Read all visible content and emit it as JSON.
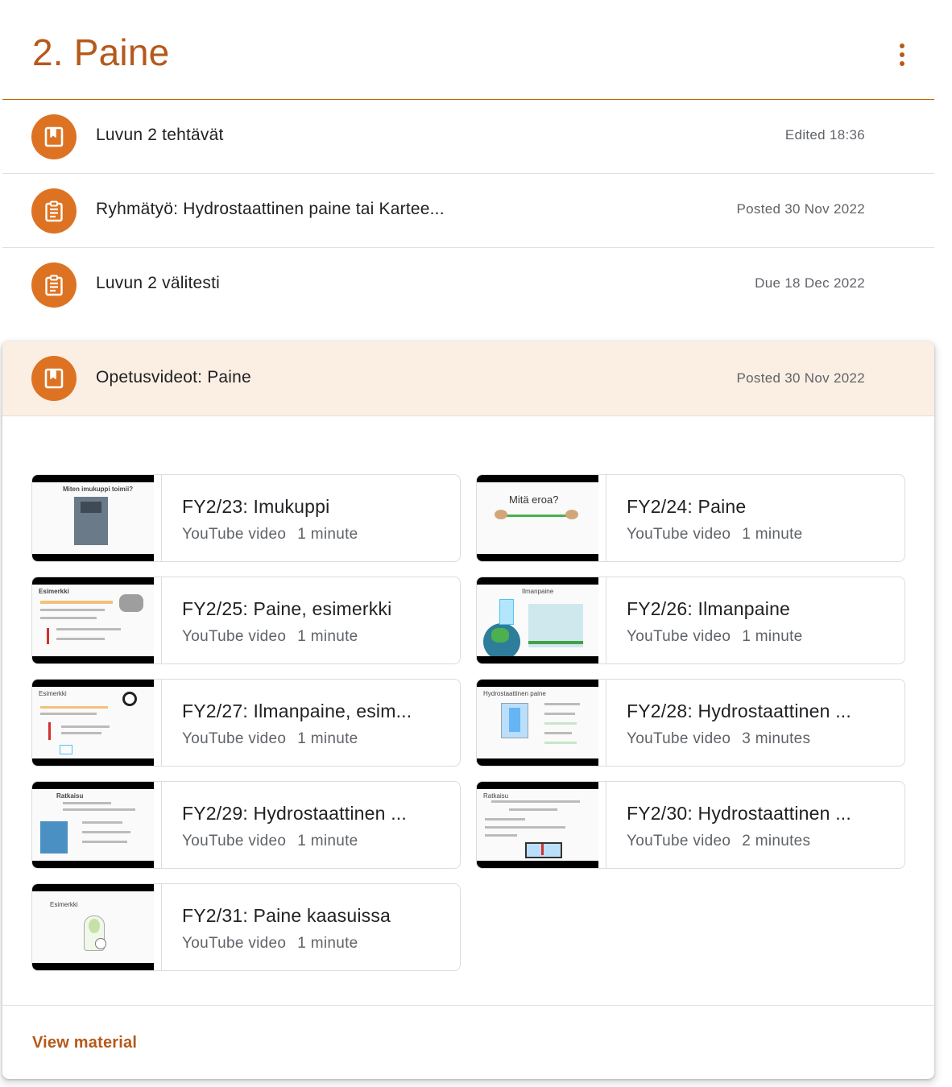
{
  "topic": {
    "title": "2. Paine"
  },
  "accent_color": "#b5591a",
  "icon_color": "#dd7322",
  "items": [
    {
      "icon": "material-icon",
      "title": "Luvun 2 tehtävät",
      "meta": "Edited 18:36"
    },
    {
      "icon": "assignment-icon",
      "title": "Ryhmätyö: Hydrostaattinen paine tai Kartee...",
      "meta": "Posted 30 Nov 2022"
    },
    {
      "icon": "assignment-icon",
      "title": "Luvun 2 välitesti",
      "meta": "Due 18 Dec 2022"
    }
  ],
  "expanded": {
    "icon": "material-icon",
    "title": "Opetusvideot: Paine",
    "meta": "Posted 30 Nov 2022",
    "view_label": "View material",
    "videos": [
      {
        "title": "FY2/23: Imukuppi",
        "source": "YouTube video",
        "duration": "1 minute",
        "thumb_caption": "Miten imukuppi toimii?"
      },
      {
        "title": "FY2/24: Paine",
        "source": "YouTube video",
        "duration": "1 minute",
        "thumb_caption": "Mitä eroa?"
      },
      {
        "title": "FY2/25: Paine, esimerkki",
        "source": "YouTube video",
        "duration": "1 minute",
        "thumb_caption": "Esimerkki"
      },
      {
        "title": "FY2/26: Ilmanpaine",
        "source": "YouTube video",
        "duration": "1 minute",
        "thumb_caption": "Ilmanpaine"
      },
      {
        "title": "FY2/27: Ilmanpaine, esim...",
        "source": "YouTube video",
        "duration": "1 minute",
        "thumb_caption": "Esimerkki"
      },
      {
        "title": "FY2/28: Hydrostaattinen ...",
        "source": "YouTube video",
        "duration": "3 minutes",
        "thumb_caption": "Hydrostaattinen paine"
      },
      {
        "title": "FY2/29: Hydrostaattinen ...",
        "source": "YouTube video",
        "duration": "1 minute",
        "thumb_caption": "Ratkaisu"
      },
      {
        "title": "FY2/30: Hydrostaattinen ...",
        "source": "YouTube video",
        "duration": "2 minutes",
        "thumb_caption": "Ratkaisu"
      },
      {
        "title": "FY2/31: Paine kaasuissa",
        "source": "YouTube video",
        "duration": "1 minute",
        "thumb_caption": "Esimerkki"
      }
    ]
  }
}
